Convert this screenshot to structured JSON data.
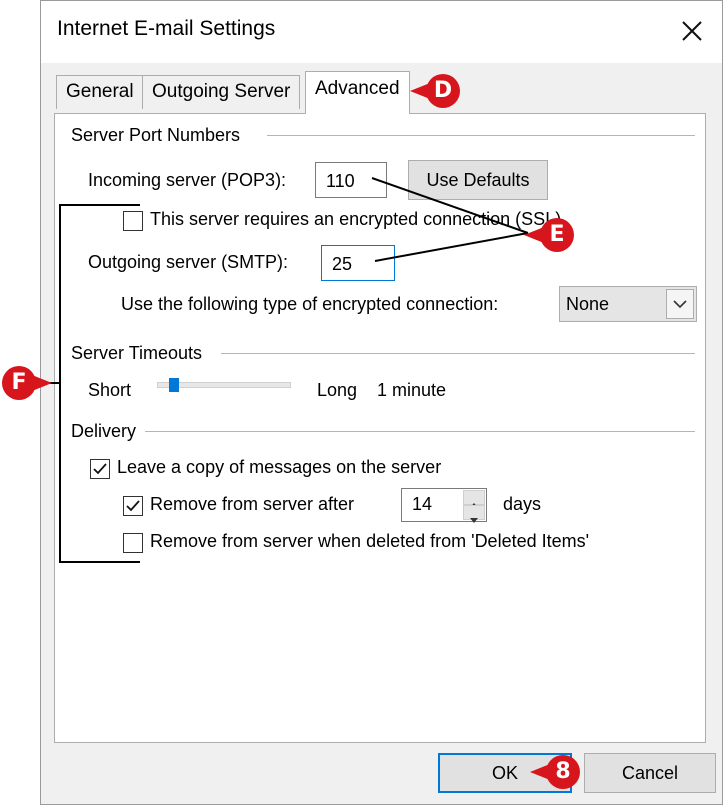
{
  "window": {
    "title": "Internet E-mail Settings"
  },
  "tabs": [
    {
      "label": "General"
    },
    {
      "label": "Outgoing Server"
    },
    {
      "label": "Advanced",
      "active": true
    }
  ],
  "server_ports": {
    "heading": "Server Port Numbers",
    "incoming_label": "Incoming server (POP3):",
    "incoming_value": "110",
    "use_defaults_label": "Use Defaults",
    "encrypted_label": "This server requires an encrypted connection (SSL)",
    "encrypted_checked": false,
    "outgoing_label": "Outgoing server (SMTP):",
    "outgoing_value": "25",
    "encryption_type_label": "Use the following type of encrypted connection:",
    "encryption_type_value": "None"
  },
  "timeouts": {
    "heading": "Server Timeouts",
    "short_label": "Short",
    "long_label": "Long",
    "value_label": "1 minute",
    "slider_level": 0.1
  },
  "delivery": {
    "heading": "Delivery",
    "leave_copy_label": "Leave a copy of messages on the server",
    "leave_copy_checked": true,
    "remove_after_label": "Remove from server after",
    "remove_after_checked": true,
    "remove_after_days": "14",
    "days_label": "days",
    "remove_deleted_label": "Remove from server when deleted from 'Deleted Items'",
    "remove_deleted_checked": false
  },
  "footer": {
    "ok_label": "OK",
    "cancel_label": "Cancel"
  },
  "callouts": {
    "d": "D",
    "e": "E",
    "f": "F",
    "eight": "8"
  },
  "colors": {
    "callout": "#d6161c",
    "accent": "#0078d7"
  }
}
